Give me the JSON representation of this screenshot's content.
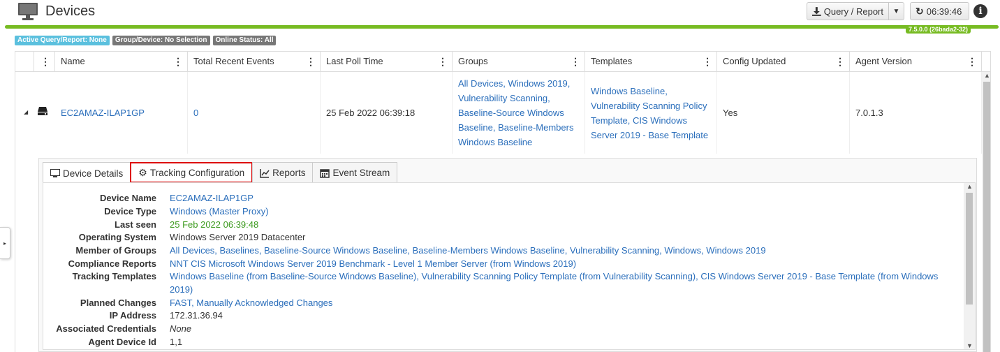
{
  "header": {
    "title": "Devices",
    "query_report_label": "Query / Report",
    "time_label": "06:39:46",
    "version": "7.5.0.0 (26bada2-32)",
    "accent_color": "#77bb22"
  },
  "badges": [
    "Active Query/Report: None",
    "Group/Device: No Selection",
    "Online Status: All"
  ],
  "grid": {
    "columns": [
      "Name",
      "Total Recent Events",
      "Last Poll Time",
      "Groups",
      "Templates",
      "Config Updated",
      "Agent Version"
    ],
    "rows": [
      {
        "name": "EC2AMAZ-ILAP1GP",
        "total_recent_events": "0",
        "last_poll_time": "25 Feb 2022 06:39:18",
        "groups": "All Devices, Windows 2019, Vulnerability Scanning, Baseline-Source Windows Baseline, Baseline-Members Windows Baseline",
        "templates": "Windows Baseline, Vulnerability Scanning Policy Template, CIS Windows Server 2019 - Base Template",
        "config_updated": "Yes",
        "agent_version": "7.0.1.3"
      }
    ]
  },
  "detail": {
    "tabs": [
      {
        "label": "Device Details",
        "icon": "monitor-icon"
      },
      {
        "label": "Tracking Configuration",
        "icon": "gear-icon"
      },
      {
        "label": "Reports",
        "icon": "line-chart-icon"
      },
      {
        "label": "Event Stream",
        "icon": "calendar-icon"
      }
    ],
    "fields": [
      {
        "label": "Device Name",
        "value": "EC2AMAZ-ILAP1GP"
      },
      {
        "label": "Device Type",
        "value": "Windows (Master Proxy)"
      },
      {
        "label": "Last seen",
        "value": "25 Feb 2022 06:39:48"
      },
      {
        "label": "Operating System",
        "value": "Windows Server 2019 Datacenter"
      },
      {
        "label": "Member of Groups",
        "value": "All Devices, Baselines, Baseline-Source Windows Baseline, Baseline-Members Windows Baseline, Vulnerability Scanning, Windows, Windows 2019"
      },
      {
        "label": "Compliance Reports",
        "value": "NNT CIS Microsoft Windows Server 2019 Benchmark - Level 1 Member Server (from Windows 2019)"
      },
      {
        "label": "Tracking Templates",
        "value": "Windows Baseline (from Baseline-Source Windows Baseline), Vulnerability Scanning Policy Template (from Vulnerability Scanning), CIS Windows Server 2019 - Base Template (from Windows 2019)"
      },
      {
        "label": "Planned Changes",
        "value": "FAST, Manually Acknowledged Changes"
      },
      {
        "label": "IP Address",
        "value": "172.31.36.94"
      },
      {
        "label": "Associated Credentials",
        "value": "None"
      },
      {
        "label": "Agent Device Id",
        "value": "1,1"
      }
    ]
  }
}
